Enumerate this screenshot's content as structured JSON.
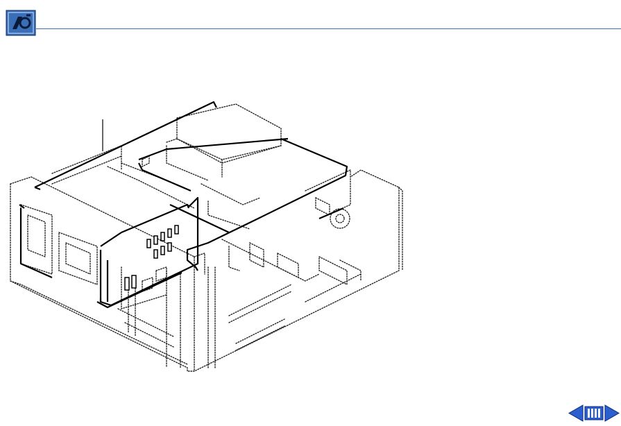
{
  "header": {
    "logo_icon": "macintosh-wrench-icon",
    "accent_color": "#3a6fb8"
  },
  "illustration": {
    "subject": "computer-chassis-exploded-view-icon"
  },
  "navigation": {
    "prev_icon": "arrow-left-icon",
    "index_icon": "index-bars-icon",
    "next_icon": "arrow-right-icon",
    "button_color": "#2b5fd0"
  }
}
